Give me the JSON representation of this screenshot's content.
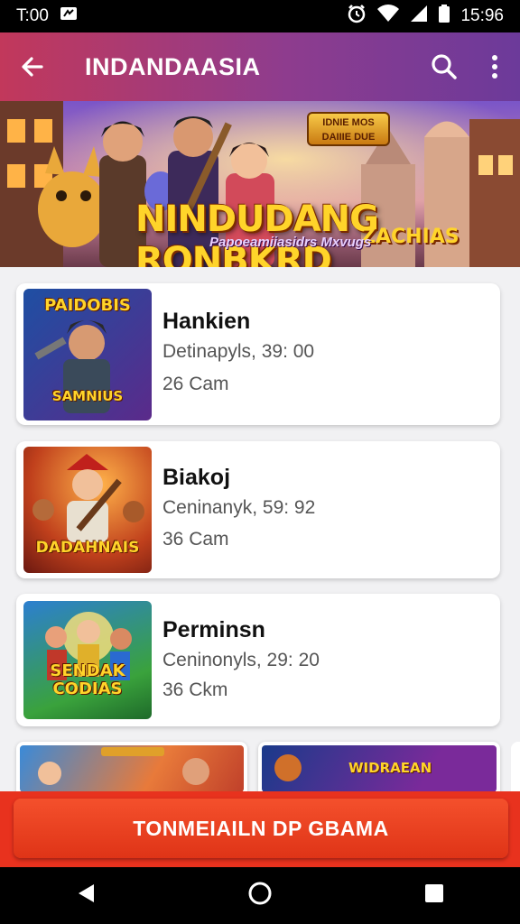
{
  "status_bar": {
    "time_left": "T:00",
    "time_right": "15:96"
  },
  "app_bar": {
    "title": "INDANDAASIA",
    "back_icon": "arrow-left-icon",
    "search_icon": "search-icon",
    "menu_icon": "more-vert-icon"
  },
  "banner": {
    "title": "NINDUDANG RONBKRD",
    "title_line2": "ZACHIAS",
    "subtitle": "Papoeamiiasidrs Mxvugs",
    "badge": "IDNIE MOS DAIIIE DUE"
  },
  "games": [
    {
      "title": "Hankien",
      "line1": "Detinapyls, 39: 00",
      "line2": "26 Cam",
      "thumb_top": "PAIDOBIS",
      "thumb_bottom": "SAMNIUS",
      "colors": [
        "#1e4fa3",
        "#5b2a8a"
      ]
    },
    {
      "title": "Biakoj",
      "line1": "Ceninanyk, 59: 92",
      "line2": "36 Cam",
      "thumb_top": "",
      "thumb_bottom": "DADAHNAIS",
      "colors": [
        "#e8752a",
        "#8a1c12"
      ]
    },
    {
      "title": "Perminsn",
      "line1": "Ceninonyls, 29: 20",
      "line2": "36 Ckm",
      "thumb_top": "",
      "thumb_bottom": "SENDAK CODIAS",
      "colors": [
        "#2c7fd0",
        "#3aa23c"
      ]
    }
  ],
  "mini_cards": [
    {
      "label": ""
    },
    {
      "label": "WIDRAEAN"
    }
  ],
  "cta": {
    "label": "TONMEIAILN DP GBAMA"
  },
  "nav": {
    "back_icon": "nav-back-icon",
    "home_icon": "nav-home-icon",
    "recents_icon": "nav-recents-icon"
  }
}
